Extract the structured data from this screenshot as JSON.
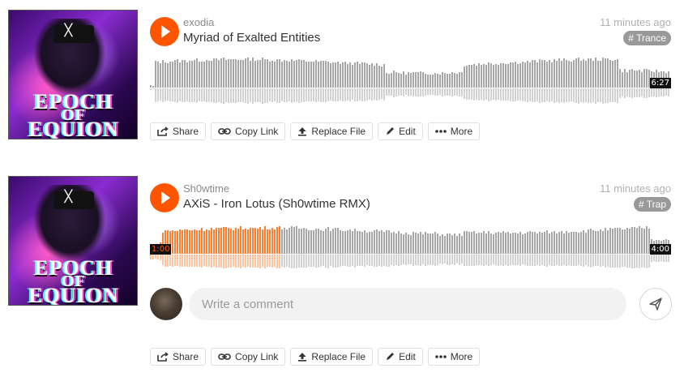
{
  "tracks": [
    {
      "artist": "exodia",
      "title": "Myriad of Exalted Entities",
      "time_ago": "11 minutes ago",
      "tag": "# Trance",
      "duration": "6:27",
      "current_time": "",
      "progress": 0,
      "artwork_text": [
        "EPOCH",
        "OF",
        "EQUION"
      ]
    },
    {
      "artist": "Sh0wtime",
      "title": "AXiS - Iron Lotus (Sh0wtime RMX)",
      "time_ago": "11 minutes ago",
      "tag": "# Trap",
      "duration": "4:00",
      "current_time": "1:00",
      "progress": 0.25,
      "artwork_text": [
        "EPOCH",
        "OF",
        "EQUION"
      ]
    }
  ],
  "actions": {
    "share": "Share",
    "copy_link": "Copy Link",
    "replace_file": "Replace File",
    "edit": "Edit",
    "more": "More"
  },
  "comment": {
    "placeholder": "Write a comment"
  },
  "colors": {
    "accent": "#ff5500",
    "played": "#ff7d2e",
    "waveform": "#a7a7a7",
    "waveform_reflection": "#d2d2d2"
  },
  "icons": {
    "play": "play-icon",
    "share": "share-icon",
    "copy_link": "link-icon",
    "replace_file": "upload-icon",
    "edit": "pencil-icon",
    "more": "ellipsis-icon",
    "send": "send-icon"
  }
}
